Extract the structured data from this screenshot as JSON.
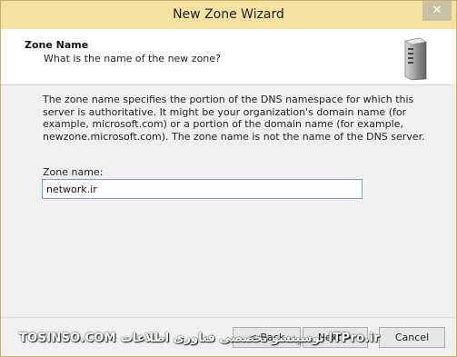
{
  "window": {
    "title": "New Zone Wizard",
    "close_glyph": "✕"
  },
  "header": {
    "title": "Zone Name",
    "subtitle": "What is the name of the new zone?",
    "icon": "server-icon"
  },
  "content": {
    "description": "The zone name specifies the portion of the DNS namespace for which this server is authoritative. It might be your organization's domain name (for example, microsoft.com) or a portion of the domain name (for example, newzone.microsoft.com). The zone name is not the name of the DNS server.",
    "zone_name_label": "Zone name:",
    "zone_name_value": "network.ir"
  },
  "buttons": {
    "back": "< Back",
    "next": "Next >",
    "cancel": "Cancel"
  },
  "watermark": {
    "text": "TOSINSO.COM  توسینسو تخصصی فناوری اطلاعات  ITPro.ir"
  }
}
